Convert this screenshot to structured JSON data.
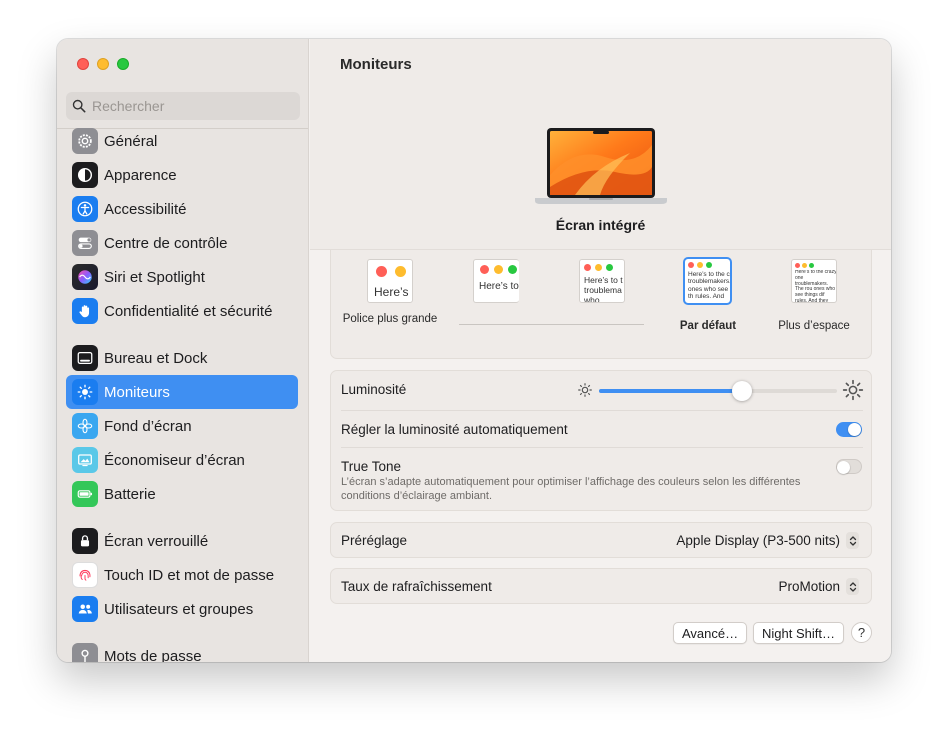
{
  "search": {
    "placeholder": "Rechercher"
  },
  "sidebar": {
    "items": [
      {
        "label": "Général",
        "icon": "gear-icon",
        "color": "#8e8e93"
      },
      {
        "label": "Apparence",
        "icon": "appearance-icon",
        "color": "#1c1c1e"
      },
      {
        "label": "Accessibilité",
        "icon": "accessibility-icon",
        "color": "#1a7df0"
      },
      {
        "label": "Centre de contrôle",
        "icon": "control-center-icon",
        "color": "#8e8e93"
      },
      {
        "label": "Siri et Spotlight",
        "icon": "siri-icon",
        "color": "#5b3dd6"
      },
      {
        "label": "Confidentialité et sécurité",
        "icon": "hand-icon",
        "color": "#1a7df0"
      },
      {
        "label": "Bureau et Dock",
        "icon": "dock-icon",
        "color": "#1c1c1e"
      },
      {
        "label": "Moniteurs",
        "icon": "sun-icon",
        "color": "#1a7df0",
        "active": true
      },
      {
        "label": "Fond d’écran",
        "icon": "flower-icon",
        "color": "#3aa7f0"
      },
      {
        "label": "Économiseur d’écran",
        "icon": "screensaver-icon",
        "color": "#5ac8e8"
      },
      {
        "label": "Batterie",
        "icon": "battery-icon",
        "color": "#34c759"
      },
      {
        "label": "Écran verrouillé",
        "icon": "lock-icon",
        "color": "#1c1c1e"
      },
      {
        "label": "Touch ID et mot de passe",
        "icon": "fingerprint-icon",
        "color": "#ffffff"
      },
      {
        "label": "Utilisateurs et groupes",
        "icon": "users-icon",
        "color": "#1a7df0"
      },
      {
        "label": "Mots de passe",
        "icon": "key-icon",
        "color": "#8e8e93"
      }
    ]
  },
  "main": {
    "title": "Moniteurs",
    "display_name": "Écran intégré",
    "resolutions": [
      {
        "label": "Police plus grande",
        "thumb_text": "Here’s",
        "selected": false
      },
      {
        "label": "",
        "thumb_text": "Here’s to troublem",
        "selected": false
      },
      {
        "label": "",
        "thumb_text": "Here’s to t troublema ones who",
        "selected": false
      },
      {
        "label": "Par défaut",
        "thumb_text": "Here’s to the c troublemakers. ones who see th rules. And they",
        "selected": true
      },
      {
        "label": "Plus d’espace",
        "thumb_text": "Here’s to the crazy one troublemakers. The rou ones who see things dif rules. And they have no can quote them, disagre them. About the only thi Because they change t",
        "selected": false
      }
    ],
    "brightness": {
      "label": "Luminosité",
      "value": 0.6
    },
    "auto_brightness": {
      "label": "Régler la luminosité automatiquement",
      "on": true
    },
    "true_tone": {
      "label": "True Tone",
      "description": "L’écran s’adapte automatiquement pour optimiser l’affichage des couleurs selon les différentes conditions d’éclairage ambiant.",
      "on": false
    },
    "preset": {
      "label": "Préréglage",
      "value": "Apple Display (P3-500 nits)"
    },
    "refresh": {
      "label": "Taux de rafraîchissement",
      "value": "ProMotion"
    },
    "buttons": {
      "advanced": "Avancé…",
      "night_shift": "Night Shift…",
      "help": "?"
    }
  },
  "colors": {
    "accent": "#3f8ff2"
  }
}
